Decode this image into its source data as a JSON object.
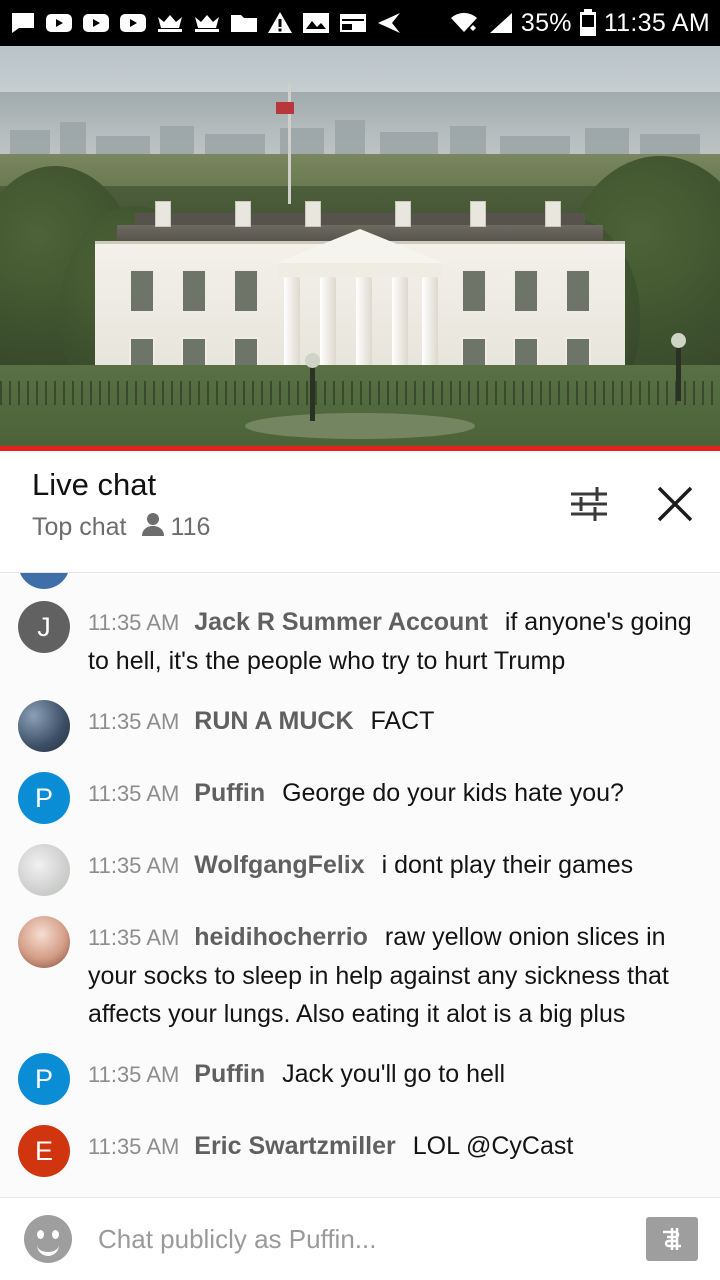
{
  "status_bar": {
    "icons": [
      "chat-bubble-icon",
      "youtube-icon",
      "youtube-icon",
      "youtube-icon",
      "crown-icon",
      "crown-icon",
      "folder-icon",
      "warning-icon",
      "image-icon",
      "calendar-icon",
      "send-icon"
    ],
    "right_icons": [
      "wifi-icon",
      "signal-icon",
      "battery-icon"
    ],
    "battery_percent": "35%",
    "clock": "11:35 AM"
  },
  "video": {
    "progress_percent": 100,
    "accent_color": "#e62117"
  },
  "chat_header": {
    "title": "Live chat",
    "mode": "Top chat",
    "viewer_count": "116",
    "viewer_icon": "person-icon",
    "settings_icon": "sliders-icon",
    "close_icon": "close-icon"
  },
  "messages": [
    {
      "partial": true,
      "timestamp": "",
      "author": "",
      "text": "",
      "avatar": {
        "type": "photo",
        "color": "#3f6ea8",
        "initial": ""
      }
    },
    {
      "timestamp": "11:35 AM",
      "author": "Jack R Summer Account",
      "text": "if anyone's going to hell, it's the people who try to hurt Trump",
      "avatar": {
        "type": "initial",
        "color": "#616161",
        "initial": "J"
      }
    },
    {
      "timestamp": "11:35 AM",
      "author": "RUN A MUCK",
      "text": "FACT",
      "avatar": {
        "type": "photo",
        "color": "#4a5f7a",
        "initial": ""
      }
    },
    {
      "timestamp": "11:35 AM",
      "author": "Puffin",
      "text": "George do your kids hate you?",
      "avatar": {
        "type": "initial",
        "color": "#0b8dd6",
        "initial": "P"
      }
    },
    {
      "timestamp": "11:35 AM",
      "author": "WolfgangFelix",
      "text": "i dont play their games",
      "avatar": {
        "type": "photo",
        "color": "#d8d8d8",
        "initial": ""
      }
    },
    {
      "timestamp": "11:35 AM",
      "author": "heidihocherrio",
      "text": "raw yellow onion slices in your socks to sleep in help against any sickness that affects your lungs. Also eating it alot is a big plus",
      "avatar": {
        "type": "photo",
        "color": "#c98f7e",
        "initial": ""
      }
    },
    {
      "timestamp": "11:35 AM",
      "author": "Puffin",
      "text": "Jack you'll go to hell",
      "avatar": {
        "type": "initial",
        "color": "#0b8dd6",
        "initial": "P"
      }
    },
    {
      "timestamp": "11:35 AM",
      "author": "Eric Swartzmiller",
      "text": "LOL @CyCast",
      "avatar": {
        "type": "initial",
        "color": "#d0350f",
        "initial": "E"
      }
    }
  ],
  "composer": {
    "placeholder": "Chat publicly as Puffin...",
    "emoji_icon": "emoji-icon",
    "send_icon": "send-message-icon"
  }
}
